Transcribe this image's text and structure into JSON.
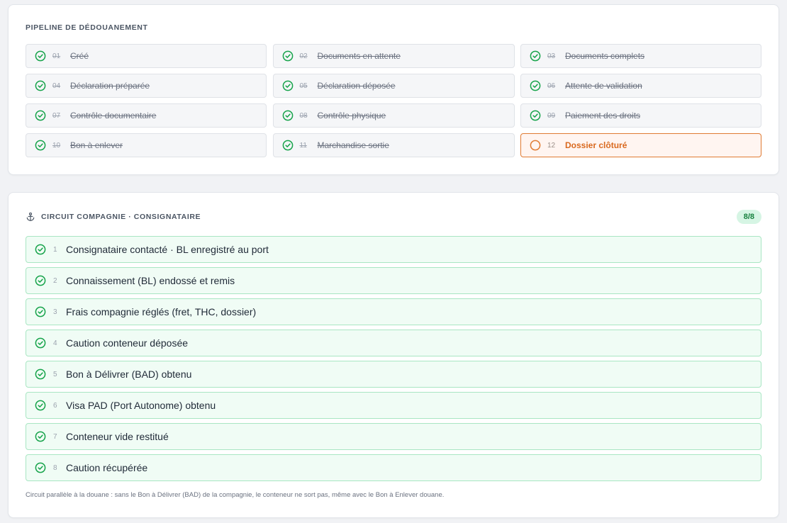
{
  "pipeline": {
    "title": "PIPELINE DE DÉDOUANEMENT",
    "steps": [
      {
        "num": "01",
        "label": "Créé",
        "status": "done"
      },
      {
        "num": "02",
        "label": "Documents en attente",
        "status": "done"
      },
      {
        "num": "03",
        "label": "Documents complets",
        "status": "done"
      },
      {
        "num": "04",
        "label": "Déclaration préparée",
        "status": "done"
      },
      {
        "num": "05",
        "label": "Déclaration déposée",
        "status": "done"
      },
      {
        "num": "06",
        "label": "Attente de validation",
        "status": "done"
      },
      {
        "num": "07",
        "label": "Contrôle documentaire",
        "status": "done"
      },
      {
        "num": "08",
        "label": "Contrôle physique",
        "status": "done"
      },
      {
        "num": "09",
        "label": "Paiement des droits",
        "status": "done"
      },
      {
        "num": "10",
        "label": "Bon à enlever",
        "status": "done"
      },
      {
        "num": "11",
        "label": "Marchandise sortie",
        "status": "done"
      },
      {
        "num": "12",
        "label": "Dossier clôturé",
        "status": "current"
      }
    ]
  },
  "circuit": {
    "title": "CIRCUIT COMPAGNIE · CONSIGNATAIRE",
    "icon": "anchor-icon",
    "count": "8/8",
    "items": [
      {
        "num": "1",
        "label": "Consignataire contacté · BL enregistré au port"
      },
      {
        "num": "2",
        "label": "Connaissement (BL) endossé et remis"
      },
      {
        "num": "3",
        "label": "Frais compagnie réglés (fret, THC, dossier)"
      },
      {
        "num": "4",
        "label": "Caution conteneur déposée"
      },
      {
        "num": "5",
        "label": "Bon à Délivrer (BAD) obtenu"
      },
      {
        "num": "6",
        "label": "Visa PAD (Port Autonome) obtenu"
      },
      {
        "num": "7",
        "label": "Conteneur vide restitué"
      },
      {
        "num": "8",
        "label": "Caution récupérée"
      }
    ],
    "note": "Circuit parallèle à la douane : sans le Bon à Délivrer (BAD) de la compagnie, le conteneur ne sort pas, même avec le Bon à Enlever douane."
  },
  "colors": {
    "done": "#16a34a",
    "current": "#e07b33",
    "badge_bg": "#d6f5e4"
  }
}
